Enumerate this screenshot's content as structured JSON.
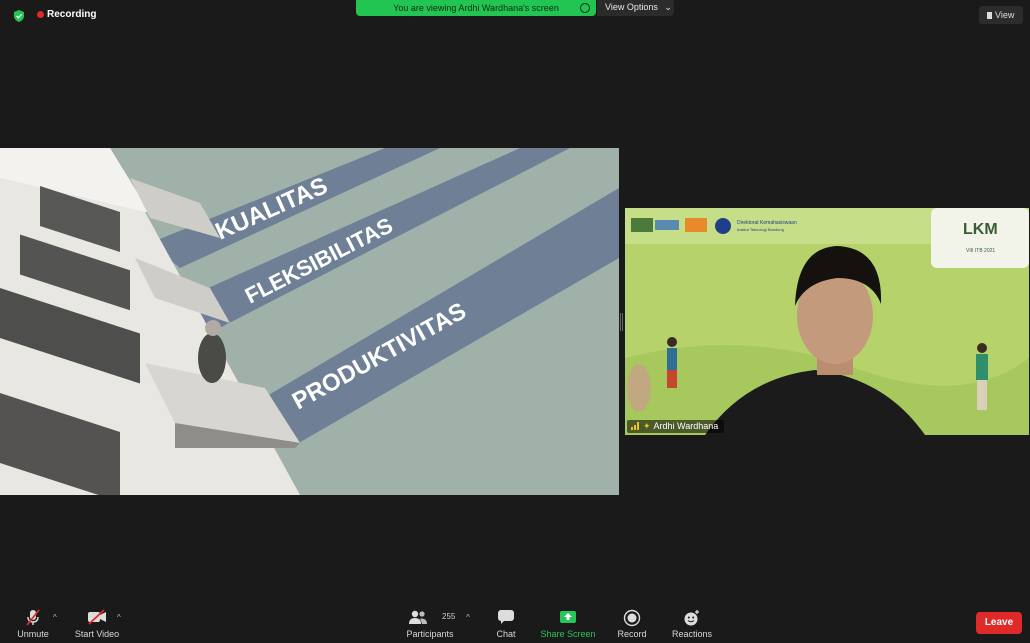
{
  "top": {
    "recording_label": "Recording",
    "viewing_banner": "You are viewing Ardhi Wardhana's screen",
    "view_options_label": "View Options",
    "view_label": "View"
  },
  "slide": {
    "words": [
      "KUALITAS",
      "FLEKSIBILITAS",
      "PRODUKTIVITAS"
    ],
    "colors": {
      "background": "#9fb1a9",
      "stripe": "#6f8096",
      "text": "#ffffff"
    }
  },
  "video": {
    "participant_name": "Ardhi Wardhana",
    "logo_text": "LKM",
    "banner_org": "Direktorat Kemahasiswaan",
    "banner_org_sub": "Institut Teknologi Bandung",
    "event_year": "VIII ITB 2021"
  },
  "toolbar": {
    "unmute": "Unmute",
    "start_video": "Start Video",
    "participants": "Participants",
    "participant_count": "255",
    "chat": "Chat",
    "share_screen": "Share Screen",
    "record": "Record",
    "reactions": "Reactions",
    "leave": "Leave",
    "accent_green": "#27c55a",
    "leave_red": "#e02a2a"
  }
}
